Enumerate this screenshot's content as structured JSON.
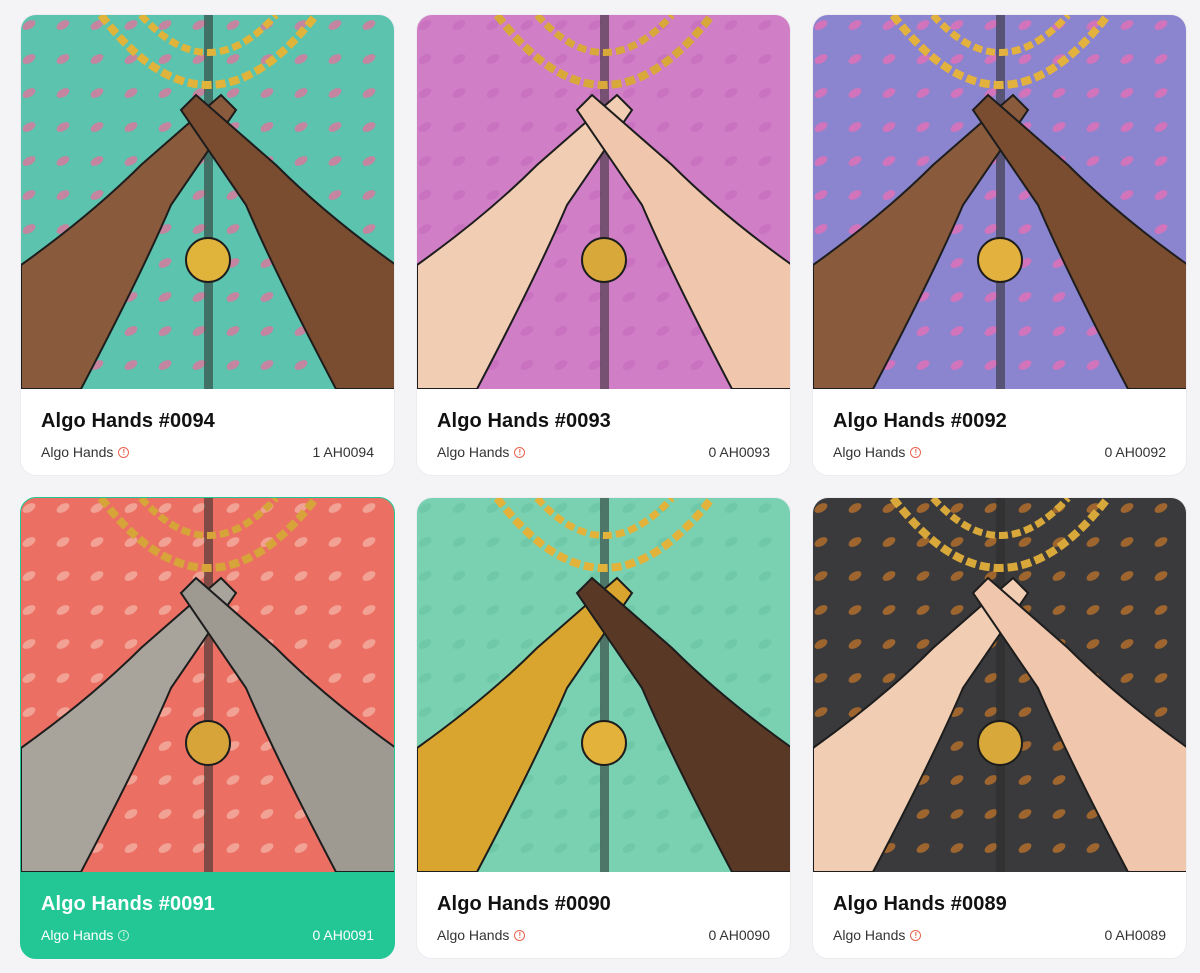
{
  "cards": [
    {
      "title": "Algo Hands #0094",
      "creator": "Algo Hands",
      "amount": "1 AH0094",
      "bg": "#5cc3ae",
      "pattern": "#e6709a",
      "skin_left": "#8a5a3c",
      "skin_right": "#7a4c30",
      "chain": "#e0b43a",
      "selected": false
    },
    {
      "title": "Algo Hands #0093",
      "creator": "Algo Hands",
      "amount": "0 AH0093",
      "bg": "#d07ec6",
      "pattern": "#c76fbd",
      "skin_left": "#f1cdb4",
      "skin_right": "#f0c7ad",
      "chain": "#d8a93a",
      "selected": false
    },
    {
      "title": "Algo Hands #0092",
      "creator": "Algo Hands",
      "amount": "0 AH0092",
      "bg": "#8b84cf",
      "pattern": "#e86fb6",
      "skin_left": "#8a5a3c",
      "skin_right": "#7a4c30",
      "chain": "#e3b13d",
      "selected": false
    },
    {
      "title": "Algo Hands #0091",
      "creator": "Algo Hands",
      "amount": "0 AH0091",
      "bg": "#ec6f64",
      "pattern": "#f4b3a6",
      "skin_left": "#a8a49c",
      "skin_right": "#9e9a92",
      "chain": "#d7a43a",
      "selected": true
    },
    {
      "title": "Algo Hands #0090",
      "creator": "Algo Hands",
      "amount": "0 AH0090",
      "bg": "#79d1b2",
      "pattern": "#6cc5a6",
      "skin_left": "#d9a52e",
      "skin_right": "#5a3826",
      "chain": "#e2b23b",
      "selected": false
    },
    {
      "title": "Algo Hands #0089",
      "creator": "Algo Hands",
      "amount": "0 AH0089",
      "bg": "#3a3a3c",
      "pattern": "#c0762a",
      "skin_left": "#f1cdb4",
      "skin_right": "#f0c7ad",
      "chain": "#d8a93a",
      "selected": false
    }
  ]
}
